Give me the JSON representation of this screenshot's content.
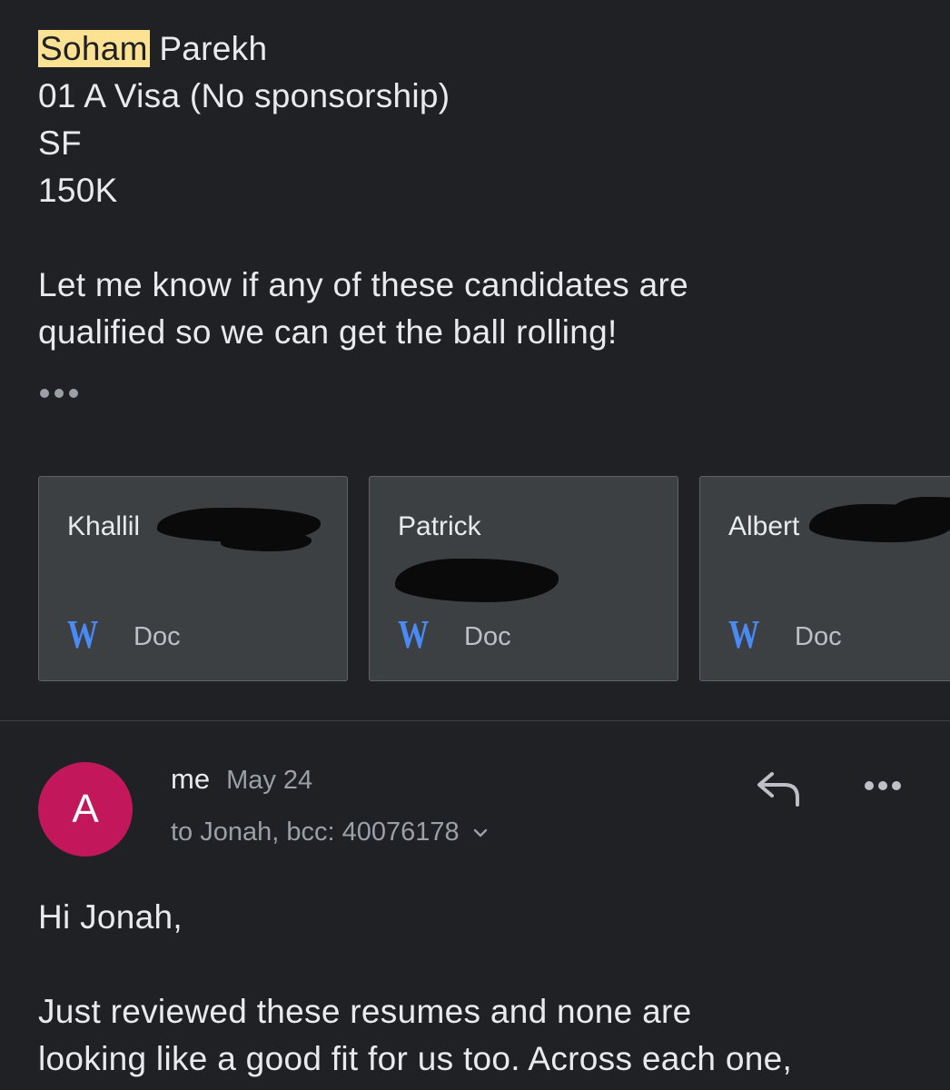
{
  "first_message": {
    "lines": {
      "name_first": "Soham",
      "name_last": "Parekh",
      "visa": "01 A Visa (No sponsorship)",
      "location": "SF",
      "salary": "150K"
    },
    "paragraph": [
      "Let me know if any of these candidates are",
      "qualified so we can get the ball rolling!"
    ],
    "ellipsis_icon": "more-horizontal-icon"
  },
  "attachments": [
    {
      "name": "Khallil",
      "type_label": "Doc",
      "icon": "word-doc-icon"
    },
    {
      "name": "Patrick",
      "type_label": "Doc",
      "icon": "word-doc-icon"
    },
    {
      "name": "Albert",
      "type_label": "Doc",
      "icon": "word-doc-icon"
    }
  ],
  "reply": {
    "avatar_initial": "A",
    "avatar_color": "#c2185b",
    "sender": "me",
    "date": "May 24",
    "recipients": "to Jonah, bcc: 40076178",
    "body_lines": [
      "Hi Jonah,",
      "",
      "Just reviewed these resumes and none are",
      "looking like a good fit for us too. Across each one,"
    ],
    "actions": {
      "reply_icon": "reply-arrow-icon",
      "more_icon": "more-horizontal-icon"
    }
  },
  "colors": {
    "background": "#202124",
    "text": "#e8eaed",
    "muted": "#9aa0a6",
    "highlight": "#fde293",
    "word_blue": "#4a8af4",
    "card_bg": "#3c4043"
  }
}
